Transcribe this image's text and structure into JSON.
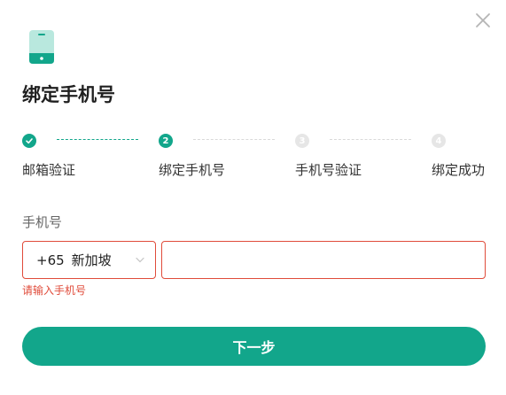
{
  "dialog": {
    "title": "绑定手机号"
  },
  "steps": [
    {
      "label": "邮箱验证",
      "marker": "",
      "status": "done"
    },
    {
      "label": "绑定手机号",
      "marker": "2",
      "status": "active"
    },
    {
      "label": "手机号验证",
      "marker": "3",
      "status": "pending"
    },
    {
      "label": "绑定成功",
      "marker": "4",
      "status": "pending"
    }
  ],
  "form": {
    "phone_label": "手机号",
    "country_code": "+65",
    "country_name": "新加坡",
    "phone_value": "",
    "error_message": "请输入手机号"
  },
  "actions": {
    "next_label": "下一步"
  },
  "colors": {
    "accent": "#12a68b",
    "error": "#e04b3a",
    "pending": "#e6e6e6"
  },
  "icons": {
    "close": "close-icon",
    "phone": "mobile-phone-icon",
    "check": "check-icon",
    "chevron": "chevron-down-icon"
  }
}
